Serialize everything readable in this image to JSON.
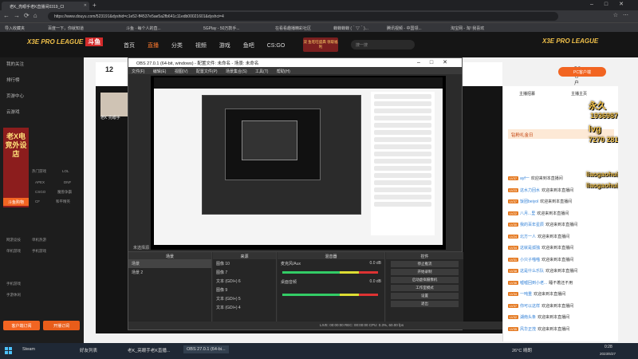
{
  "browser": {
    "tab_title": "老K_亮眼手老K直播间0319_Cl",
    "url": "https://www.douyu.com/523191&dyshid=c1e52-ff4537e5ae5a2fb641c11edb00021601&dyshci=4",
    "bookmarks": [
      "导入收藏夹",
      "百度一下，你就知道",
      "斗鱼 · 每个人的直...",
      "5GPlay - 50万款手...",
      "在看看趣播精彩社区",
      "蝉蝉蝉蝉 (＾▽＾)...",
      "腾讯视频 - 中国领...",
      "淘宝网 - 淘! 我喜欢"
    ]
  },
  "header": {
    "logo_text": "X3E PRO LEAGUE",
    "logo_badge": "斗鱼",
    "nav": [
      "首页",
      "直播",
      "分类",
      "视频",
      "游戏",
      "鱼吧",
      "CS:GO"
    ],
    "active_nav": "直播",
    "promo": "双 鱼旺旺盛典 领取福利",
    "search_placeholder": "搜一搜",
    "right_logo": "X3E PRO LEAGUE"
  },
  "leftnav": {
    "items": [
      "我的关注",
      "排行榜",
      "页游中心",
      "云游戏"
    ],
    "grid": [
      "热门游戏",
      "LOL",
      "APEX",
      "DNF",
      "CSGO",
      "魔兽争霸",
      "CF",
      "和平精英",
      "网游竞技",
      "单机热游",
      "单机游戏",
      "手机游戏"
    ],
    "sections": [
      "手机游戏",
      "手游休闲"
    ],
    "buttons": [
      "客户端订阅",
      "开播订阅"
    ],
    "banner": "老X电竞外设店",
    "banner_btn": "斗鱼购物"
  },
  "room": {
    "viewer_count": "12",
    "anchor_name": "老K 亮眼手",
    "button": "PC客户端"
  },
  "obs": {
    "title": "OBS 27.0.1 (64-bit, windows) - 配置文件: 未命名 - 场景: 未命名",
    "menu": [
      "文件(F)",
      "编辑(E)",
      "视图(V)",
      "配置文件(P)",
      "场景集合(S)",
      "工具(T)",
      "帮助(H)"
    ],
    "docks": {
      "scenes_title": "场景",
      "scenes": [
        "场景",
        "场景 2"
      ],
      "sources_title": "来源",
      "sources": [
        "图像 10",
        "图像 7",
        "文本 (GDI+) 6",
        "图像 9",
        "文本 (GDI+) 5",
        "文本 (GDI+) 4"
      ],
      "mixer_title": "混音器",
      "mixer": [
        {
          "name": "麦克风/Aux",
          "db": "0.0 dB"
        },
        {
          "name": "桌面音频",
          "db": "0.0 dB"
        }
      ],
      "controls_title": "控件",
      "controls": [
        "停止推流",
        "开始录制",
        "启动虚拟摄像机",
        "工作室模式",
        "设置",
        "退出"
      ],
      "transition": "转场特效"
    },
    "status": "LIVE: 00:00:00   REC: 00:00:00   CPU: 0.3%, 60.00 fps",
    "bottom_label": "未选择源"
  },
  "chat": {
    "header_items": [
      "主播招募",
      "主播主页"
    ],
    "notice": "钻粉礼金日",
    "messages": [
      {
        "level": "LV37",
        "user": "ayf一",
        "text": "欢迎来到本直播间"
      },
      {
        "level": "LV23",
        "user": "这水力回水",
        "text": "欢迎来到本直播间"
      },
      {
        "level": "LV37",
        "user": "饭团beiyol",
        "text": "欢迎来到本直播间"
      },
      {
        "level": "LV22",
        "user": "八月...里",
        "text": "欢迎来到本直播间"
      },
      {
        "level": "LV30",
        "user": "我的百年星辰",
        "text": "欢迎来到本直播间"
      },
      {
        "level": "LV24",
        "user": "北方一人",
        "text": "欢迎来到本直播间"
      },
      {
        "level": "LV34",
        "user": "这就是孤独",
        "text": "欢迎来到本直播间"
      },
      {
        "level": "LV31",
        "user": "小只子喵喵",
        "text": "欢迎来到本直播间"
      },
      {
        "level": "LV38",
        "user": "这是什么乐队",
        "text": "欢迎来到本直播间"
      },
      {
        "level": "LV36",
        "user": "嘘嘘回到小老...",
        "text": "睡不着还不用"
      },
      {
        "level": "LV34",
        "user": "一吨重",
        "text": "欢迎来到本直播间"
      },
      {
        "level": "LV37",
        "user": "你可以这样",
        "text": "欢迎来到本直播间"
      },
      {
        "level": "LV32",
        "user": "湖南头条",
        "text": "欢迎来到本直播间"
      },
      {
        "level": "LV35",
        "user": "风华正茂",
        "text": "欢迎来到本直播间"
      }
    ],
    "overlay_lines": [
      "永久",
      "1936987",
      "lvg",
      "7270 2811",
      "liaogaohuijia",
      "liaogaohuijia"
    ]
  },
  "taskbar": {
    "apps": [
      "Steam",
      "好友列表",
      "老K_亮眼手老K直播...",
      "OBS 27.0.1 (64-bi..."
    ],
    "weather": "26°C 晴朗",
    "time": "0:28",
    "date": "2023/6/27"
  }
}
